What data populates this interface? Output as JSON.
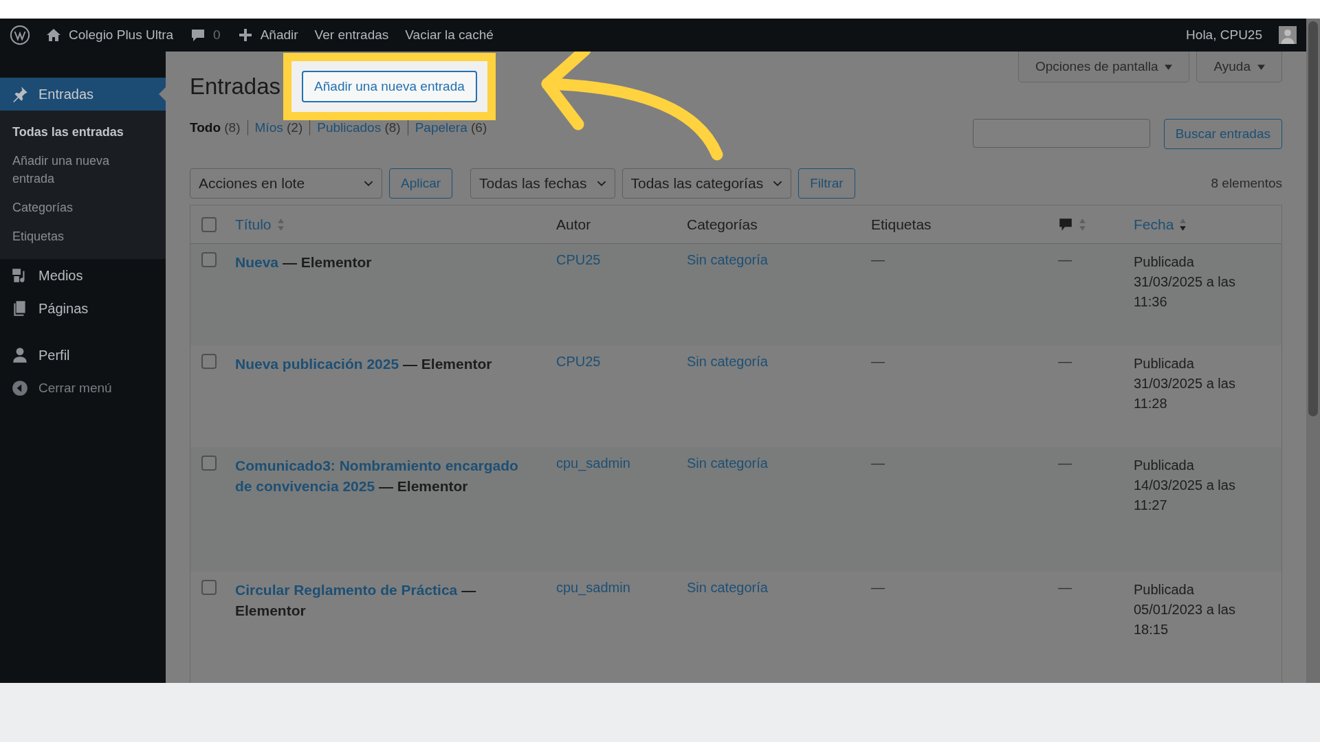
{
  "admin_bar": {
    "site": "Colegio Plus Ultra",
    "comments": "0",
    "add": "Añadir",
    "links": [
      "Ver entradas",
      "Vaciar la caché"
    ],
    "greeting": "Hola, CPU25"
  },
  "sidebar": {
    "items": [
      {
        "label": "Entradas",
        "selected": true,
        "submenu": [
          {
            "label": "Todas las entradas",
            "selected": true
          },
          {
            "label": "Añadir una nueva entrada",
            "selected": false
          },
          {
            "label": "Categorías",
            "selected": false
          },
          {
            "label": "Etiquetas",
            "selected": false
          }
        ]
      },
      {
        "label": "Medios",
        "selected": false
      },
      {
        "label": "Páginas",
        "selected": false
      },
      {
        "label": "Perfil",
        "selected": false
      }
    ],
    "collapse": "Cerrar menú"
  },
  "screen_options": "Opciones de pantalla",
  "help": "Ayuda",
  "page": {
    "title": "Entradas",
    "add_button": "Añadir una nueva entrada"
  },
  "views": [
    {
      "label": "Todo",
      "count": "(8)",
      "selected": true
    },
    {
      "label": "Míos",
      "count": "(2)",
      "selected": false
    },
    {
      "label": "Publicados",
      "count": "(8)",
      "selected": false
    },
    {
      "label": "Papelera",
      "count": "(6)",
      "selected": false
    }
  ],
  "search": {
    "button": "Buscar entradas"
  },
  "toolbar": {
    "bulk": "Acciones en lote",
    "apply": "Aplicar",
    "dates": "Todas las fechas",
    "categories": "Todas las categorías",
    "filter": "Filtrar",
    "count": "8 elementos"
  },
  "table": {
    "select_all_checked": false,
    "columns": {
      "title": "Título",
      "author": "Autor",
      "categories": "Categorías",
      "tags": "Etiquetas",
      "date": "Fecha"
    },
    "rows": [
      {
        "checked": false,
        "title": "Nueva",
        "suffix": "— Elementor",
        "author": "CPU25",
        "category": "Sin categoría",
        "tags": "—",
        "comments": "—",
        "status": "Publicada",
        "date": "31/03/2025 a las",
        "time": "11:36"
      },
      {
        "checked": false,
        "title": "Nueva publicación 2025",
        "suffix": "— Elementor",
        "author": "CPU25",
        "category": "Sin categoría",
        "tags": "—",
        "comments": "—",
        "status": "Publicada",
        "date": "31/03/2025 a las",
        "time": "11:28"
      },
      {
        "checked": false,
        "title": "Comunicado3: Nombramiento encargado de convivencia 2025",
        "suffix": "— Elementor",
        "author": "cpu_sadmin",
        "category": "Sin categoría",
        "tags": "—",
        "comments": "—",
        "status": "Publicada",
        "date": "14/03/2025 a las",
        "time": "11:27"
      },
      {
        "checked": false,
        "title": "Circular Reglamento de Práctica",
        "suffix": "— Elementor",
        "author": "cpu_sadmin",
        "category": "Sin categoría",
        "tags": "—",
        "comments": "—",
        "status": "Publicada",
        "date": "05/01/2023 a las",
        "time": "18:15"
      }
    ]
  }
}
